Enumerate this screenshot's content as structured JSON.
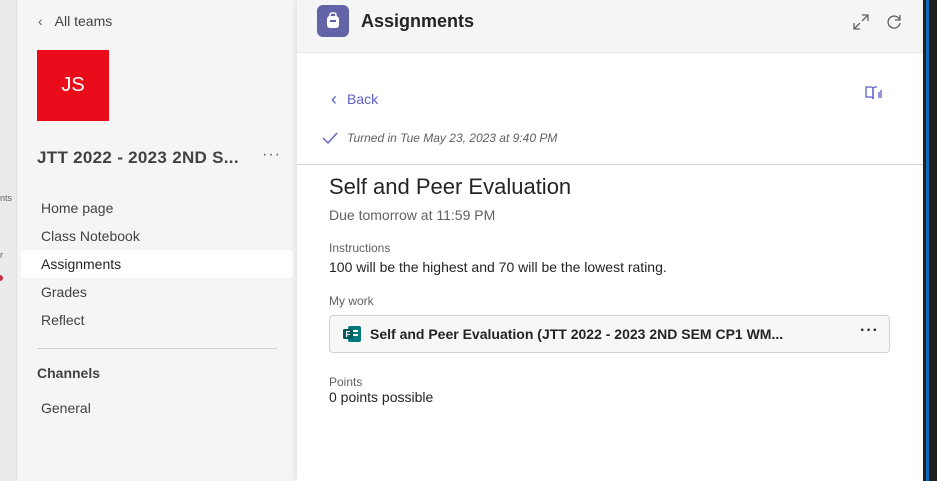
{
  "rail": {
    "text_1": "nts",
    "text_2": "r"
  },
  "sidebar": {
    "back_label": "All teams",
    "team_initials": "JS",
    "team_name": "JTT 2022 - 2023 2ND S...",
    "more": "···",
    "nav": [
      {
        "label": "Home page",
        "active": false
      },
      {
        "label": "Class Notebook",
        "active": false
      },
      {
        "label": "Assignments",
        "active": true
      },
      {
        "label": "Grades",
        "active": false
      },
      {
        "label": "Reflect",
        "active": false
      }
    ],
    "channels_title": "Channels",
    "channels": [
      {
        "label": "General"
      }
    ]
  },
  "header": {
    "title": "Assignments"
  },
  "assignment": {
    "back_label": "Back",
    "turned_in": "Turned in Tue May 23, 2023 at 9:40 PM",
    "title": "Self and Peer Evaluation",
    "due": "Due tomorrow at 11:59 PM",
    "instructions_label": "Instructions",
    "instructions": "100 will be the highest and 70 will be the lowest rating.",
    "my_work_label": "My work",
    "work_item": "Self and Peer Evaluation (JTT 2022 - 2023 2ND SEM CP1 WM...",
    "work_more": "···",
    "points_label": "Points",
    "points": "0 points possible"
  },
  "colors": {
    "team_avatar": "#ea0b1b",
    "accent": "#5b5fc7",
    "app_icon": "#6264a7",
    "forms_green": "#038387"
  }
}
